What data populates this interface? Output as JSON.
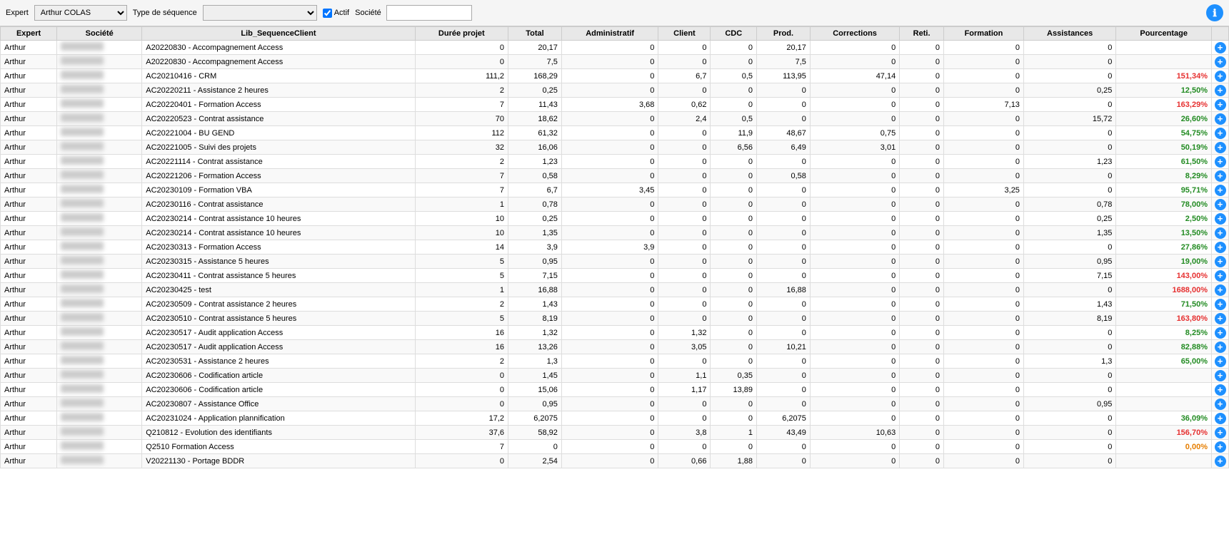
{
  "toolbar": {
    "expert_label": "Expert",
    "expert_value": "Arthur COLAS",
    "type_sequence_label": "Type de séquence",
    "actif_label": "Actif",
    "actif_checked": true,
    "societe_label": "Société",
    "societe_value": "",
    "info_icon": "ℹ"
  },
  "table": {
    "headers": [
      "Expert",
      "Société",
      "Lib_SequenceClient",
      "Durée projet",
      "Total",
      "Administratif",
      "Client",
      "CDC",
      "Prod.",
      "Corrections",
      "Reti.",
      "Formation",
      "Assistances",
      "Pourcentage",
      ""
    ],
    "rows": [
      {
        "expert": "Arthur",
        "societe": "BLUR",
        "lib": "A20220830 - Accompagnement Access",
        "duree": "0",
        "total": "20,17",
        "admin": "0",
        "client": "0",
        "cdc": "0",
        "prod": "20,17",
        "corrections": "0",
        "reti": "0",
        "formation": "0",
        "assistances": "0",
        "pct": "",
        "pct_class": ""
      },
      {
        "expert": "Arthur",
        "societe": "BLUR",
        "lib": "A20220830 - Accompagnement Access",
        "duree": "0",
        "total": "7,5",
        "admin": "0",
        "client": "0",
        "cdc": "0",
        "prod": "7,5",
        "corrections": "0",
        "reti": "0",
        "formation": "0",
        "assistances": "0",
        "pct": "",
        "pct_class": ""
      },
      {
        "expert": "Arthur",
        "societe": "BLUR",
        "lib": "AC20210416 - CRM",
        "duree": "111,2",
        "total": "168,29",
        "admin": "0",
        "client": "6,7",
        "cdc": "0,5",
        "prod": "113,95",
        "corrections": "47,14",
        "reti": "0",
        "formation": "0",
        "assistances": "0",
        "pct": "151,34%",
        "pct_class": "pct-red"
      },
      {
        "expert": "Arthur",
        "societe": "BLUR",
        "lib": "AC20220211 - Assistance 2 heures",
        "duree": "2",
        "total": "0,25",
        "admin": "0",
        "client": "0",
        "cdc": "0",
        "prod": "0",
        "corrections": "0",
        "reti": "0",
        "formation": "0",
        "assistances": "0,25",
        "pct": "12,50%",
        "pct_class": "pct-green"
      },
      {
        "expert": "Arthur",
        "societe": "BLUR",
        "lib": "AC20220401 - Formation Access",
        "duree": "7",
        "total": "11,43",
        "admin": "3,68",
        "client": "0,62",
        "cdc": "0",
        "prod": "0",
        "corrections": "0",
        "reti": "0",
        "formation": "7,13",
        "assistances": "0",
        "pct": "163,29%",
        "pct_class": "pct-red"
      },
      {
        "expert": "Arthur",
        "societe": "BLUR",
        "lib": "AC20220523 - Contrat assistance",
        "duree": "70",
        "total": "18,62",
        "admin": "0",
        "client": "2,4",
        "cdc": "0,5",
        "prod": "0",
        "corrections": "0",
        "reti": "0",
        "formation": "0",
        "assistances": "15,72",
        "pct": "26,60%",
        "pct_class": "pct-green"
      },
      {
        "expert": "Arthur",
        "societe": "BLUR",
        "lib": "AC20221004 - BU GEND",
        "duree": "112",
        "total": "61,32",
        "admin": "0",
        "client": "0",
        "cdc": "11,9",
        "prod": "48,67",
        "corrections": "0,75",
        "reti": "0",
        "formation": "0",
        "assistances": "0",
        "pct": "54,75%",
        "pct_class": "pct-green"
      },
      {
        "expert": "Arthur",
        "societe": "BLUR",
        "lib": "AC20221005 - Suivi des projets",
        "duree": "32",
        "total": "16,06",
        "admin": "0",
        "client": "0",
        "cdc": "6,56",
        "prod": "6,49",
        "corrections": "3,01",
        "reti": "0",
        "formation": "0",
        "assistances": "0",
        "pct": "50,19%",
        "pct_class": "pct-green"
      },
      {
        "expert": "Arthur",
        "societe": "BLUR",
        "lib": "AC20221114 - Contrat assistance",
        "duree": "2",
        "total": "1,23",
        "admin": "0",
        "client": "0",
        "cdc": "0",
        "prod": "0",
        "corrections": "0",
        "reti": "0",
        "formation": "0",
        "assistances": "1,23",
        "pct": "61,50%",
        "pct_class": "pct-green"
      },
      {
        "expert": "Arthur",
        "societe": "BLUR",
        "lib": "AC20221206 - Formation Access",
        "duree": "7",
        "total": "0,58",
        "admin": "0",
        "client": "0",
        "cdc": "0",
        "prod": "0,58",
        "corrections": "0",
        "reti": "0",
        "formation": "0",
        "assistances": "0",
        "pct": "8,29%",
        "pct_class": "pct-green"
      },
      {
        "expert": "Arthur",
        "societe": "BLUR",
        "lib": "AC20230109 - Formation VBA",
        "duree": "7",
        "total": "6,7",
        "admin": "3,45",
        "client": "0",
        "cdc": "0",
        "prod": "0",
        "corrections": "0",
        "reti": "0",
        "formation": "3,25",
        "assistances": "0",
        "pct": "95,71%",
        "pct_class": "pct-green"
      },
      {
        "expert": "Arthur",
        "societe": "BLUR",
        "lib": "AC20230116 - Contrat assistance",
        "duree": "1",
        "total": "0,78",
        "admin": "0",
        "client": "0",
        "cdc": "0",
        "prod": "0",
        "corrections": "0",
        "reti": "0",
        "formation": "0",
        "assistances": "0,78",
        "pct": "78,00%",
        "pct_class": "pct-green"
      },
      {
        "expert": "Arthur",
        "societe": "BLUR",
        "lib": "AC20230214 - Contrat assistance 10 heures",
        "duree": "10",
        "total": "0,25",
        "admin": "0",
        "client": "0",
        "cdc": "0",
        "prod": "0",
        "corrections": "0",
        "reti": "0",
        "formation": "0",
        "assistances": "0,25",
        "pct": "2,50%",
        "pct_class": "pct-green"
      },
      {
        "expert": "Arthur",
        "societe": "BLUR",
        "lib": "AC20230214 - Contrat assistance 10 heures",
        "duree": "10",
        "total": "1,35",
        "admin": "0",
        "client": "0",
        "cdc": "0",
        "prod": "0",
        "corrections": "0",
        "reti": "0",
        "formation": "0",
        "assistances": "1,35",
        "pct": "13,50%",
        "pct_class": "pct-green"
      },
      {
        "expert": "Arthur",
        "societe": "BLUR",
        "lib": "AC20230313 - Formation Access",
        "duree": "14",
        "total": "3,9",
        "admin": "3,9",
        "client": "0",
        "cdc": "0",
        "prod": "0",
        "corrections": "0",
        "reti": "0",
        "formation": "0",
        "assistances": "0",
        "pct": "27,86%",
        "pct_class": "pct-green"
      },
      {
        "expert": "Arthur",
        "societe": "BLUR",
        "lib": "AC20230315 - Assistance 5 heures",
        "duree": "5",
        "total": "0,95",
        "admin": "0",
        "client": "0",
        "cdc": "0",
        "prod": "0",
        "corrections": "0",
        "reti": "0",
        "formation": "0",
        "assistances": "0,95",
        "pct": "19,00%",
        "pct_class": "pct-green"
      },
      {
        "expert": "Arthur",
        "societe": "BLUR",
        "lib": "AC20230411 - Contrat assistance 5 heures",
        "duree": "5",
        "total": "7,15",
        "admin": "0",
        "client": "0",
        "cdc": "0",
        "prod": "0",
        "corrections": "0",
        "reti": "0",
        "formation": "0",
        "assistances": "7,15",
        "pct": "143,00%",
        "pct_class": "pct-red"
      },
      {
        "expert": "Arthur",
        "societe": "BLUR",
        "lib": "AC20230425 - test",
        "duree": "1",
        "total": "16,88",
        "admin": "0",
        "client": "0",
        "cdc": "0",
        "prod": "16,88",
        "corrections": "0",
        "reti": "0",
        "formation": "0",
        "assistances": "0",
        "pct": "1688,00%",
        "pct_class": "pct-red"
      },
      {
        "expert": "Arthur",
        "societe": "BLUR",
        "lib": "AC20230509 - Contrat assistance 2 heures",
        "duree": "2",
        "total": "1,43",
        "admin": "0",
        "client": "0",
        "cdc": "0",
        "prod": "0",
        "corrections": "0",
        "reti": "0",
        "formation": "0",
        "assistances": "1,43",
        "pct": "71,50%",
        "pct_class": "pct-green"
      },
      {
        "expert": "Arthur",
        "societe": "BLUR",
        "lib": "AC20230510 - Contrat assistance 5 heures",
        "duree": "5",
        "total": "8,19",
        "admin": "0",
        "client": "0",
        "cdc": "0",
        "prod": "0",
        "corrections": "0",
        "reti": "0",
        "formation": "0",
        "assistances": "8,19",
        "pct": "163,80%",
        "pct_class": "pct-red"
      },
      {
        "expert": "Arthur",
        "societe": "BLUR",
        "lib": "AC20230517 - Audit application Access",
        "duree": "16",
        "total": "1,32",
        "admin": "0",
        "client": "1,32",
        "cdc": "0",
        "prod": "0",
        "corrections": "0",
        "reti": "0",
        "formation": "0",
        "assistances": "0",
        "pct": "8,25%",
        "pct_class": "pct-green"
      },
      {
        "expert": "Arthur",
        "societe": "BLUR",
        "lib": "AC20230517 - Audit application Access",
        "duree": "16",
        "total": "13,26",
        "admin": "0",
        "client": "3,05",
        "cdc": "0",
        "prod": "10,21",
        "corrections": "0",
        "reti": "0",
        "formation": "0",
        "assistances": "0",
        "pct": "82,88%",
        "pct_class": "pct-green"
      },
      {
        "expert": "Arthur",
        "societe": "BLUR",
        "lib": "AC20230531 - Assistance 2 heures",
        "duree": "2",
        "total": "1,3",
        "admin": "0",
        "client": "0",
        "cdc": "0",
        "prod": "0",
        "corrections": "0",
        "reti": "0",
        "formation": "0",
        "assistances": "1,3",
        "pct": "65,00%",
        "pct_class": "pct-green"
      },
      {
        "expert": "Arthur",
        "societe": "BLUR",
        "lib": "AC20230606 - Codification article",
        "duree": "0",
        "total": "1,45",
        "admin": "0",
        "client": "1,1",
        "cdc": "0,35",
        "prod": "0",
        "corrections": "0",
        "reti": "0",
        "formation": "0",
        "assistances": "0",
        "pct": "",
        "pct_class": ""
      },
      {
        "expert": "Arthur",
        "societe": "BLUR",
        "lib": "AC20230606 - Codification article",
        "duree": "0",
        "total": "15,06",
        "admin": "0",
        "client": "1,17",
        "cdc": "13,89",
        "prod": "0",
        "corrections": "0",
        "reti": "0",
        "formation": "0",
        "assistances": "0",
        "pct": "",
        "pct_class": ""
      },
      {
        "expert": "Arthur",
        "societe": "BLUR",
        "lib": "AC20230807 - Assistance Office",
        "duree": "0",
        "total": "0,95",
        "admin": "0",
        "client": "0",
        "cdc": "0",
        "prod": "0",
        "corrections": "0",
        "reti": "0",
        "formation": "0",
        "assistances": "0,95",
        "pct": "",
        "pct_class": ""
      },
      {
        "expert": "Arthur",
        "societe": "BLUR",
        "lib": "AC20231024 - Application plannification",
        "duree": "17,2",
        "total": "6,2075",
        "admin": "0",
        "client": "0",
        "cdc": "0",
        "prod": "6,2075",
        "corrections": "0",
        "reti": "0",
        "formation": "0",
        "assistances": "0",
        "pct": "36,09%",
        "pct_class": "pct-green"
      },
      {
        "expert": "Arthur",
        "societe": "BLUR",
        "lib": "Q210812 - Evolution des identifiants",
        "duree": "37,6",
        "total": "58,92",
        "admin": "0",
        "client": "3,8",
        "cdc": "1",
        "prod": "43,49",
        "corrections": "10,63",
        "reti": "0",
        "formation": "0",
        "assistances": "0",
        "pct": "156,70%",
        "pct_class": "pct-red"
      },
      {
        "expert": "Arthur",
        "societe": "BLUR",
        "lib": "Q2510 Formation Access",
        "duree": "7",
        "total": "0",
        "admin": "0",
        "client": "0",
        "cdc": "0",
        "prod": "0",
        "corrections": "0",
        "reti": "0",
        "formation": "0",
        "assistances": "0",
        "pct": "0,00%",
        "pct_class": "pct-orange"
      },
      {
        "expert": "Arthur",
        "societe": "BLUR",
        "lib": "V20221130 - Portage BDDR",
        "duree": "0",
        "total": "2,54",
        "admin": "0",
        "client": "0,66",
        "cdc": "1,88",
        "prod": "0",
        "corrections": "0",
        "reti": "0",
        "formation": "0",
        "assistances": "0",
        "pct": "",
        "pct_class": ""
      }
    ]
  }
}
